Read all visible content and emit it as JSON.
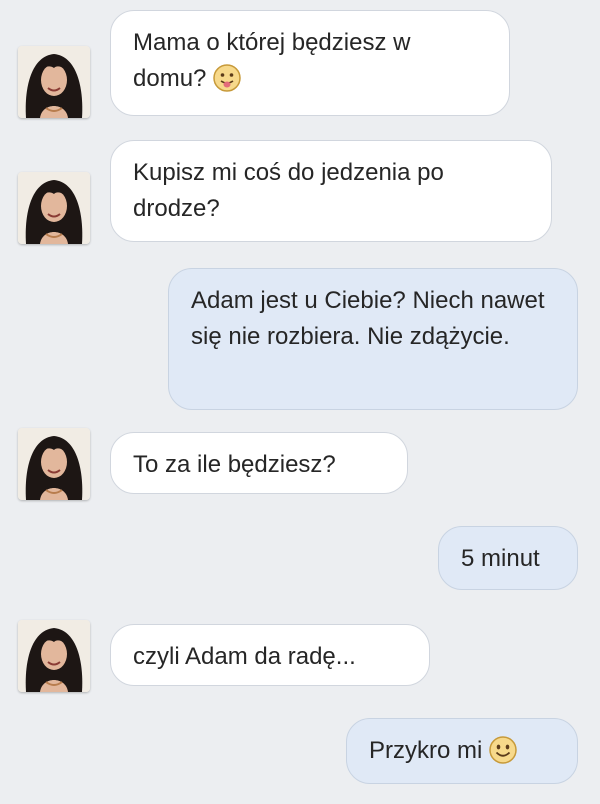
{
  "messages": [
    {
      "direction": "in",
      "text": "Mama o której będziesz w domu?",
      "emoji": "tongue-out-emoji"
    },
    {
      "direction": "in",
      "text": "Kupisz mi coś do jedzenia po drodze?"
    },
    {
      "direction": "out",
      "text": "Adam jest u Ciebie? Niech nawet się nie rozbiera. Nie zdążycie."
    },
    {
      "direction": "in",
      "text": "To za ile będziesz?"
    },
    {
      "direction": "out",
      "text": "5 minut"
    },
    {
      "direction": "in",
      "text": "czyli Adam da radę..."
    },
    {
      "direction": "out",
      "text": "Przykro mi",
      "emoji": "smile-emoji"
    }
  ],
  "colors": {
    "background": "#eceef1",
    "incoming_bubble": "#ffffff",
    "outgoing_bubble": "#e0e9f6",
    "text": "#262626"
  }
}
